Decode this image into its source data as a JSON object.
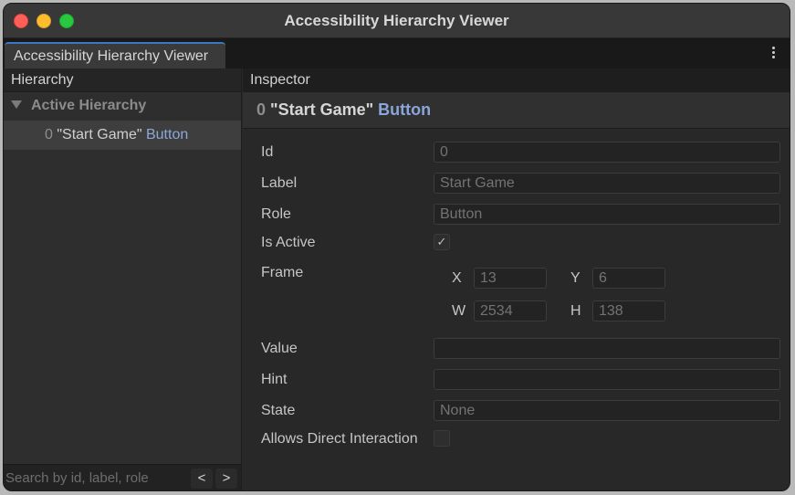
{
  "window": {
    "title": "Accessibility Hierarchy Viewer"
  },
  "tab": {
    "label": "Accessibility Hierarchy Viewer"
  },
  "hierarchy": {
    "header": "Hierarchy",
    "group_label": "Active Hierarchy",
    "items": [
      {
        "id": "0",
        "label": "\"Start Game\"",
        "role": "Button"
      }
    ],
    "search_placeholder": "Search by id, label, role",
    "prev_label": "<",
    "next_label": ">"
  },
  "inspector": {
    "header": "Inspector",
    "title": {
      "id": "0",
      "label": "\"Start Game\"",
      "role": "Button"
    },
    "fields": {
      "id": {
        "label": "Id",
        "value": "0"
      },
      "label": {
        "label": "Label",
        "value": "Start Game"
      },
      "role": {
        "label": "Role",
        "value": "Button"
      },
      "is_active": {
        "label": "Is Active",
        "checked": true,
        "check_glyph": "✓"
      },
      "frame": {
        "label": "Frame",
        "x_label": "X",
        "x": "13",
        "y_label": "Y",
        "y": "6",
        "w_label": "W",
        "w": "2534",
        "h_label": "H",
        "h": "138"
      },
      "value": {
        "label": "Value",
        "value": ""
      },
      "hint": {
        "label": "Hint",
        "value": ""
      },
      "state": {
        "label": "State",
        "value": "None"
      },
      "allows_direct_interaction": {
        "label": "Allows Direct Interaction",
        "checked": false
      }
    }
  },
  "colors": {
    "accent_tab": "#3b78c4",
    "role_text": "#8da7d8",
    "close": "#ff5f57",
    "minimize": "#febc2e",
    "maximize": "#28c840"
  }
}
